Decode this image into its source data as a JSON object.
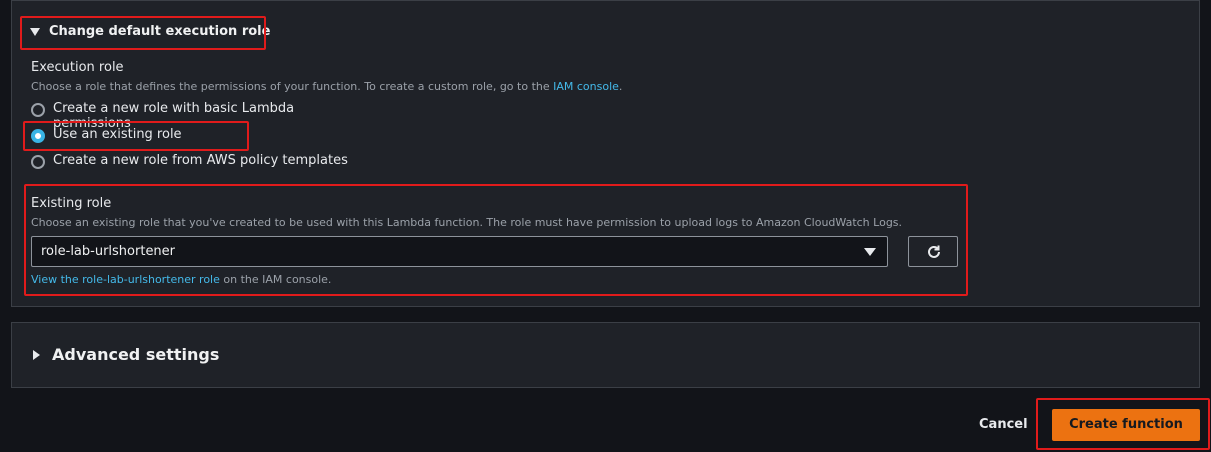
{
  "execution_role_section": {
    "toggle_label": "Change default execution role",
    "title": "Execution role",
    "description": "Choose a role that defines the permissions of your function. To create a custom role, go to the",
    "description_link": "IAM console",
    "description_end": ".",
    "options": [
      {
        "label": "Create a new role with basic Lambda permissions",
        "selected": false
      },
      {
        "label": "Use an existing role",
        "selected": true
      },
      {
        "label": "Create a new role from AWS policy templates",
        "selected": false
      }
    ]
  },
  "existing_role": {
    "title": "Existing role",
    "description": "Choose an existing role that you've created to be used with this Lambda function. The role must have permission to upload logs to Amazon CloudWatch Logs.",
    "selected_value": "role-lab-urlshortener",
    "view_link": "View the role-lab-urlshortener role",
    "view_suffix": " on the IAM console."
  },
  "advanced_settings": {
    "label": "Advanced settings"
  },
  "footer": {
    "cancel_label": "Cancel",
    "create_label": "Create function"
  },
  "colors": {
    "accent_link": "#44b9e9",
    "primary_button": "#ec7211",
    "highlight": "#e01b1b",
    "background": "#121419",
    "panel": "#1f2228"
  },
  "icons": {
    "refresh": "refresh-icon",
    "dropdown": "caret-down-icon"
  }
}
